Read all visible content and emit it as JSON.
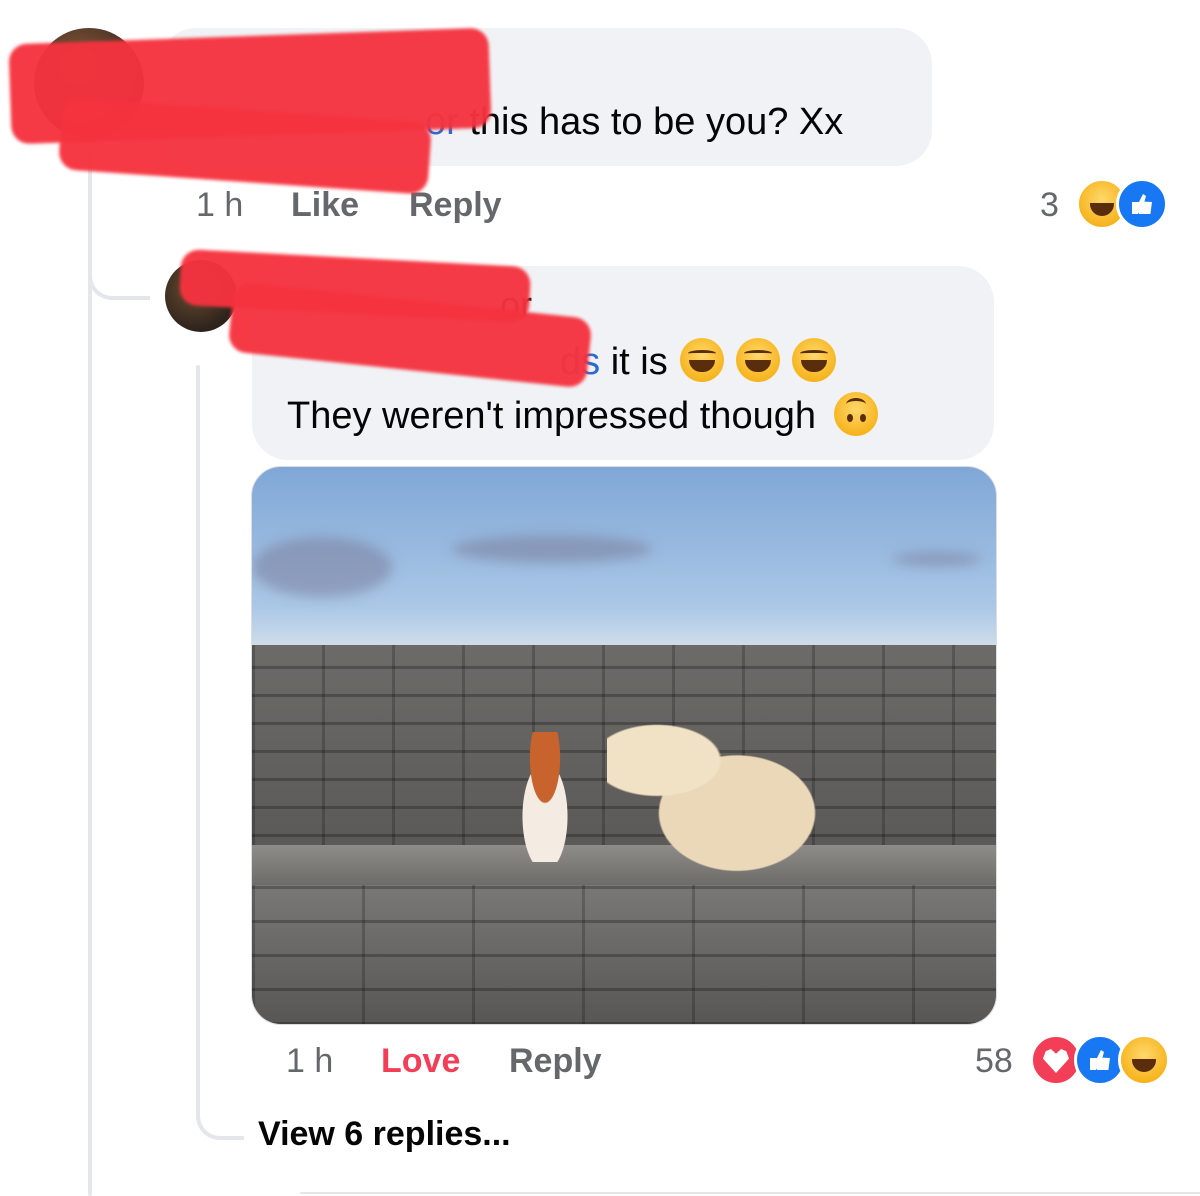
{
  "comment1": {
    "mention_fragment": "or",
    "text": " this has to be you? Xx",
    "time": "1 h",
    "like_label": "Like",
    "reply_label": "Reply",
    "reaction_count": "3",
    "reactions": [
      "haha-icon",
      "like-icon"
    ]
  },
  "comment2": {
    "name_fragment": "or",
    "mention_fragment": "ds",
    "line1_text": " it is",
    "line1_emojis": [
      "face-with-tears-of-joy",
      "face-with-tears-of-joy",
      "face-with-tears-of-joy"
    ],
    "line2_text": "They weren't impressed though",
    "line2_emoji": "upside-down-face",
    "time": "1 h",
    "love_label": "Love",
    "reply_label": "Reply",
    "reaction_count": "58",
    "reactions": [
      "love-icon",
      "like-icon",
      "haha-icon"
    ]
  },
  "view_replies_label": "View 6 replies...",
  "colors": {
    "bubble": "#f0f2f5",
    "mention": "#2a6ad1",
    "love": "#f33e58",
    "meta": "#65676b",
    "like": "#1877f2"
  }
}
